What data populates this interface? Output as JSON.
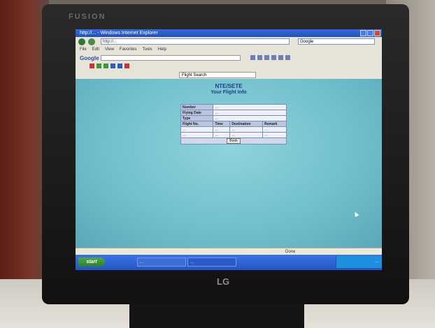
{
  "monitor": {
    "brand": "FUSION",
    "logo": "LG"
  },
  "browser": {
    "title": "http://...  - Windows Internet Explorer",
    "address": "http://...",
    "search_placeholder": "Google",
    "menu": [
      "File",
      "Edit",
      "View",
      "Favorites",
      "Tools",
      "Help"
    ],
    "google_label": "Google",
    "active_tab": "Flight Search",
    "status": "Done"
  },
  "page": {
    "title": "NTE/SETE",
    "subtitle": "Your Flight Info",
    "form": {
      "rows": [
        {
          "label": "Number",
          "value": "…"
        },
        {
          "label": "Flying Date",
          "value": "…"
        },
        {
          "label": "Type",
          "value": "…"
        }
      ],
      "headers": [
        "Flight No.",
        "Time",
        "Destination",
        "Remark"
      ],
      "flights": [
        {
          "no": "…",
          "time": "…",
          "destination": "…",
          "remark": "…"
        },
        {
          "no": "…",
          "time": "…",
          "destination": "…",
          "remark": "…"
        }
      ],
      "button_label": "Book"
    }
  },
  "taskbar": {
    "start_label": "start",
    "tasks": [
      "…",
      "…"
    ],
    "clock": "…"
  }
}
